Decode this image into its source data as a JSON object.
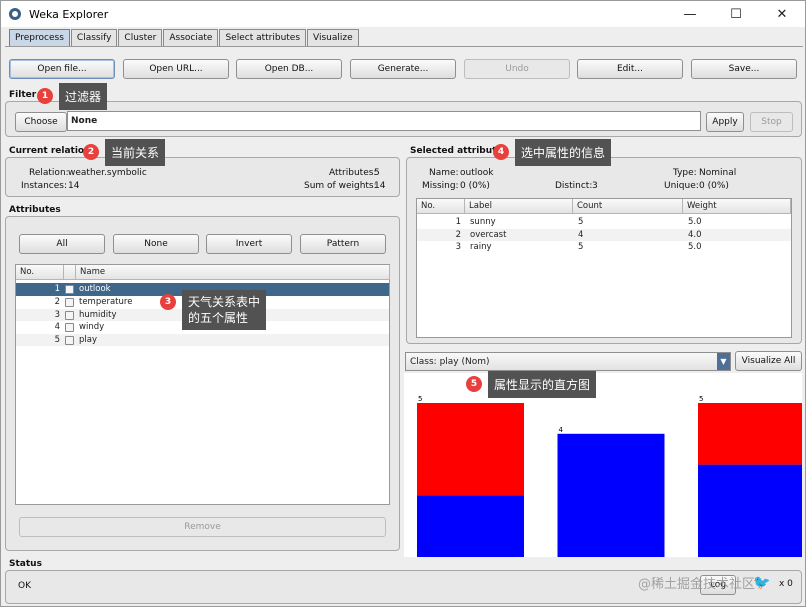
{
  "window": {
    "title": "Weka Explorer",
    "controls": [
      "—",
      "☐",
      "✕"
    ]
  },
  "tabs": [
    "Preprocess",
    "Classify",
    "Cluster",
    "Associate",
    "Select attributes",
    "Visualize"
  ],
  "toolbar": {
    "open_file": "Open file...",
    "open_url": "Open URL...",
    "open_db": "Open DB...",
    "generate": "Generate...",
    "undo": "Undo",
    "edit": "Edit...",
    "save": "Save..."
  },
  "filter": {
    "section": "Filter",
    "choose": "Choose",
    "value": "None",
    "apply": "Apply",
    "stop": "Stop"
  },
  "current_relation": {
    "section": "Current relation",
    "relation_label": "Relation:",
    "relation": "weather.symbolic",
    "instances_label": "Instances:",
    "instances": "14",
    "attributes_label": "Attributes:",
    "attributes": "5",
    "sum_weights_label": "Sum of weights:",
    "sum_weights": "14"
  },
  "attributes": {
    "section": "Attributes",
    "buttons": {
      "all": "All",
      "none": "None",
      "invert": "Invert",
      "pattern": "Pattern"
    },
    "columns": {
      "no": "No.",
      "name": "Name"
    },
    "rows": [
      {
        "no": "1",
        "name": "outlook"
      },
      {
        "no": "2",
        "name": "temperature"
      },
      {
        "no": "3",
        "name": "humidity"
      },
      {
        "no": "4",
        "name": "windy"
      },
      {
        "no": "5",
        "name": "play"
      }
    ],
    "remove": "Remove"
  },
  "selected_attribute": {
    "section": "Selected attribute",
    "name_label": "Name:",
    "name": "outlook",
    "type_label": "Type:",
    "type": "Nominal",
    "missing_label": "Missing:",
    "missing": "0 (0%)",
    "distinct_label": "Distinct:",
    "distinct": "3",
    "unique_label": "Unique:",
    "unique": "0 (0%)",
    "columns": {
      "no": "No.",
      "label": "Label",
      "count": "Count",
      "weight": "Weight"
    },
    "rows": [
      {
        "no": "1",
        "label": "sunny",
        "count": "5",
        "weight": "5.0"
      },
      {
        "no": "2",
        "label": "overcast",
        "count": "4",
        "weight": "4.0"
      },
      {
        "no": "3",
        "label": "rainy",
        "count": "5",
        "weight": "5.0"
      }
    ]
  },
  "class_selector": {
    "value": "Class: play (Nom)",
    "visualize_all": "Visualize All"
  },
  "chart_data": {
    "type": "bar",
    "categories": [
      "sunny",
      "overcast",
      "rainy"
    ],
    "series": [
      {
        "color": "#0000ff",
        "values": [
          2,
          4,
          3
        ]
      },
      {
        "color": "#ff0000",
        "values": [
          3,
          0,
          2
        ]
      }
    ],
    "totals": [
      5,
      4,
      5
    ],
    "ylim": [
      0,
      5
    ]
  },
  "status": {
    "section": "Status",
    "text": "OK",
    "log": "Log",
    "x_count": "x 0"
  },
  "annotations": [
    {
      "badge": "1",
      "text": "过滤器"
    },
    {
      "badge": "2",
      "text": "当前关系"
    },
    {
      "badge": "3",
      "text": "天气关系表中\n的五个属性"
    },
    {
      "badge": "4",
      "text": "选中属性的信息"
    },
    {
      "badge": "5",
      "text": "属性显示的直方图"
    }
  ],
  "watermark": "@稀土掘金技术社区",
  "colors": {
    "selected_row": "#3f6789",
    "active_tab": "#c9d7e6",
    "badge": "#e8413d",
    "callout_bg": "#525252"
  }
}
